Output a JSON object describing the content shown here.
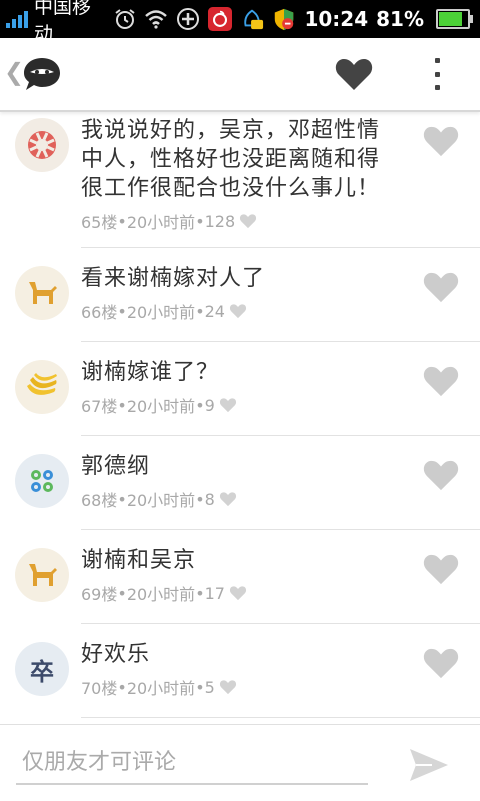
{
  "status_bar": {
    "carrier": "中国移动",
    "time": "10:24",
    "battery_percent": "81%",
    "battery_level": 0.81,
    "icons": [
      "signal-icon",
      "alarm-icon",
      "wifi-icon",
      "add-circle-icon",
      "netease-music-icon",
      "qq-icon",
      "security-shield-icon",
      "battery-icon"
    ]
  },
  "app_bar": {
    "icons": [
      "back-chevron-icon",
      "app-logo-icon",
      "heart-icon",
      "more-vert-icon"
    ]
  },
  "comments": [
    {
      "text": "我说说好的，吴京，邓超性情中人，性格好也没距离随和得很工作很配合也没什么事儿！",
      "floor": "65楼",
      "time": "20小时前",
      "likes": "128",
      "avatar": "lifebuoy-icon"
    },
    {
      "text": "看来谢楠嫁对人了",
      "floor": "66楼",
      "time": "20小时前",
      "likes": "24",
      "avatar": "dog-icon"
    },
    {
      "text": "谢楠嫁谁了？",
      "floor": "67楼",
      "time": "20小时前",
      "likes": "9",
      "avatar": "banana-icon"
    },
    {
      "text": "郭德纲",
      "floor": "68楼",
      "time": "20小时前",
      "likes": "8",
      "avatar": "buttons-icon"
    },
    {
      "text": "谢楠和吴京",
      "floor": "69楼",
      "time": "20小时前",
      "likes": "17",
      "avatar": "dog-icon"
    },
    {
      "text": "好欢乐",
      "floor": "70楼",
      "time": "20小时前",
      "likes": "5",
      "avatar": "character-icon"
    }
  ],
  "avatar_char": "卒",
  "separator": " • ",
  "comment_input": {
    "placeholder": "仅朋友才可评论"
  },
  "colors": {
    "accent": "#e05a3c",
    "heart_dark": "#444444",
    "heart_light": "#cccccc",
    "text": "#333333",
    "meta": "#a8a8a8"
  }
}
